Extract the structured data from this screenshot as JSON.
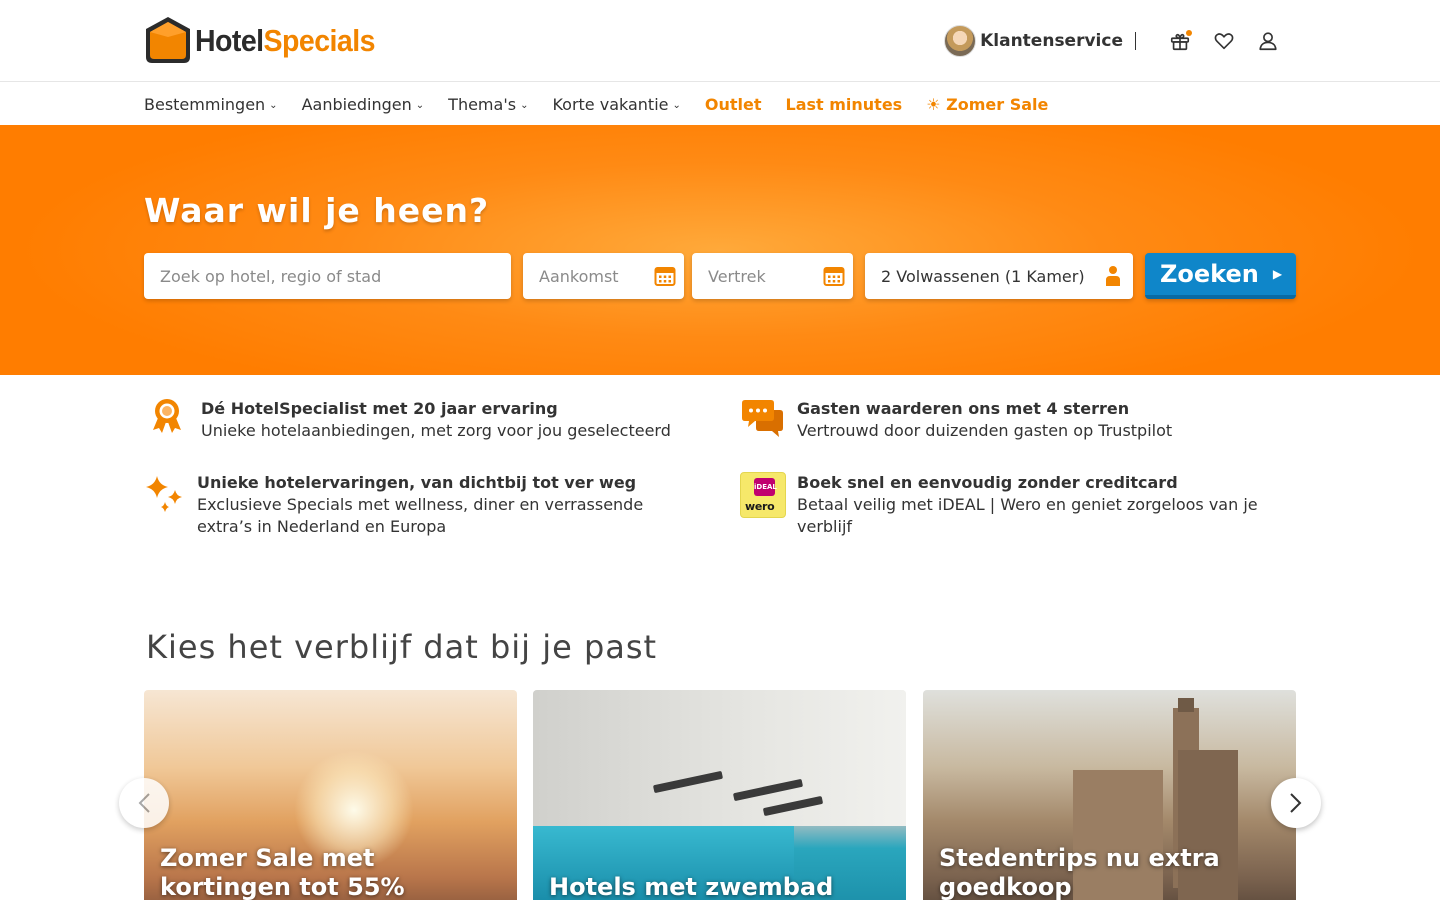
{
  "logo": {
    "part1": "Hotel",
    "part2": "Specials"
  },
  "header": {
    "customer_service": "Klantenservice",
    "icons": [
      "gift-icon",
      "heart-icon",
      "user-icon"
    ]
  },
  "nav": {
    "items": [
      {
        "label": "Bestemmingen"
      },
      {
        "label": "Aanbiedingen"
      },
      {
        "label": "Thema's"
      },
      {
        "label": "Korte vakantie"
      },
      {
        "label": "Outlet"
      },
      {
        "label": "Last minutes"
      },
      {
        "label": "☀ Zomer Sale"
      }
    ]
  },
  "hero": {
    "title": "Waar wil je heen?",
    "search_placeholder": "Zoek op hotel, regio of stad",
    "arrival_placeholder": "Aankomst",
    "departure_placeholder": "Vertrek",
    "guests_value": "2 Volwassenen (1 Kamer)",
    "search_button": "Zoeken"
  },
  "usps": [
    {
      "title": "Dé HotelSpecialist met 20 jaar ervaring",
      "text": "Unieke hotelaanbiedingen, met zorg voor jou geselecteerd",
      "icon": "award-icon"
    },
    {
      "title": "Gasten waarderen ons met 4 sterren",
      "text": "Vertrouwd door duizenden gasten op Trustpilot",
      "icon": "chat-bubbles-icon"
    },
    {
      "title": "Unieke hotelervaringen, van dichtbij tot ver weg",
      "text": "Exclusieve Specials met wellness, diner en verrassende extra’s in Nederland en Europa",
      "icon": "sparkles-icon"
    },
    {
      "title": "Boek snel en eenvoudig zonder creditcard",
      "text": "Betaal veilig met iDEAL | Wero en geniet zorgeloos van je verblijf",
      "icon": "ideal-wero-icon",
      "badge_top": "iDEAL",
      "badge_bottom": "wero"
    }
  ],
  "section": {
    "title": "Kies het verblijf dat bij je past"
  },
  "cards": [
    {
      "title": "Zomer Sale met kortingen tot 55%"
    },
    {
      "title": "Hotels met zwembad"
    },
    {
      "title": "Stedentrips nu extra goedkoop"
    }
  ],
  "colors": {
    "brand_orange": "#f28500",
    "hero_orange": "#ff8a14",
    "button_blue": "#0f86c9"
  }
}
